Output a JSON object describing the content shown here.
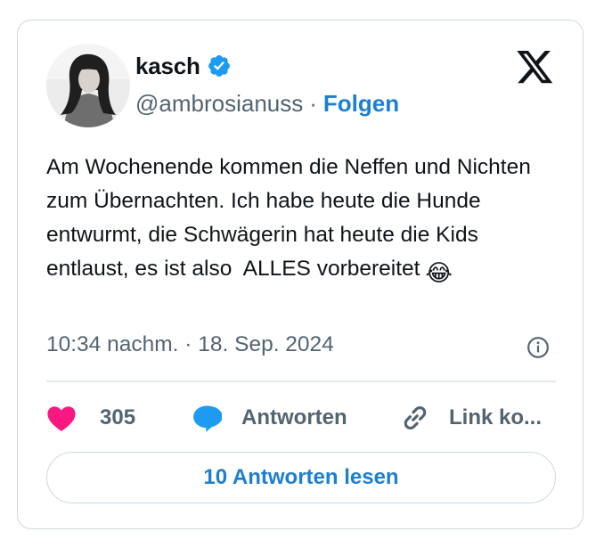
{
  "author": {
    "display_name": "kasch",
    "verified": true,
    "handle": "@ambrosianuss",
    "separator": "·",
    "follow_label": "Folgen",
    "avatar_icon": "user-photo-avatar"
  },
  "brand_icon": "x-logo-icon",
  "tweet": {
    "text": "Am Wochenende kommen die Neffen und Nichten zum Übernachten. Ich habe heute die Hunde entwurmt, die Schwägerin hat heute die Kids entlaust, es ist also  ALLES vorbereitet",
    "emoji": "😂",
    "timestamp": "10:34 nachm. · 18. Sep. 2024"
  },
  "actions": {
    "like_count": "305",
    "reply_label": "Antworten",
    "link_label": "Link ko..."
  },
  "read_replies_label": "10 Antworten lesen",
  "colors": {
    "accent": "#1d7fd1",
    "like": "#f91880",
    "verified": "#1d9bf0",
    "muted": "#536471",
    "border": "#cfd9de"
  }
}
